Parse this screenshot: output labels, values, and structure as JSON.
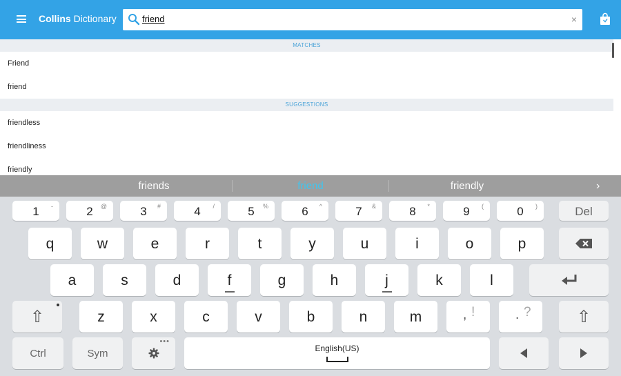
{
  "app": {
    "title_bold": "Collins",
    "title_rest": "Dictionary"
  },
  "search": {
    "query": "friend",
    "clear_glyph": "×"
  },
  "results": {
    "matches_header": "MATCHES",
    "matches": [
      "Friend",
      "friend"
    ],
    "suggestions_header": "SUGGESTIONS",
    "suggestions": [
      "friendless",
      "friendliness",
      "friendly"
    ]
  },
  "suggestion_strip": {
    "items": [
      "friends",
      "friend",
      "friendly"
    ],
    "more_glyph": "›"
  },
  "keyboard": {
    "number_row": [
      {
        "main": "1",
        "sec": "-"
      },
      {
        "main": "2",
        "sec": "@"
      },
      {
        "main": "3",
        "sec": "#"
      },
      {
        "main": "4",
        "sec": "/"
      },
      {
        "main": "5",
        "sec": "%"
      },
      {
        "main": "6",
        "sec": "^"
      },
      {
        "main": "7",
        "sec": "&"
      },
      {
        "main": "8",
        "sec": "*"
      },
      {
        "main": "9",
        "sec": "("
      },
      {
        "main": "0",
        "sec": ")"
      }
    ],
    "del_label": "Del",
    "row_q": [
      "q",
      "w",
      "e",
      "r",
      "t",
      "y",
      "u",
      "i",
      "o",
      "p"
    ],
    "row_a": [
      "a",
      "s",
      "d",
      "f",
      "g",
      "h",
      "j",
      "k",
      "l"
    ],
    "row_z": [
      "z",
      "x",
      "c",
      "v",
      "b",
      "n",
      "m"
    ],
    "comma": {
      "main": ",",
      "alt": "!"
    },
    "period": {
      "main": ".",
      "alt": "?"
    },
    "ctrl_label": "Ctrl",
    "sym_label": "Sym",
    "space_label": "English(US)",
    "dots": "•••",
    "shift_glyph": "⇧"
  },
  "colors": {
    "accent": "#33a3e6",
    "suggestion_highlight": "#3fc6ef",
    "keyboard_bg": "#dadde1"
  },
  "icons": {
    "menu": "menu-icon",
    "search": "search-icon",
    "clear": "close-icon",
    "store": "shopping-bag-icon",
    "backspace": "backspace-icon",
    "enter": "enter-icon",
    "shift": "shift-icon",
    "settings": "gear-icon",
    "left": "arrow-left-icon",
    "right": "arrow-right-icon"
  }
}
